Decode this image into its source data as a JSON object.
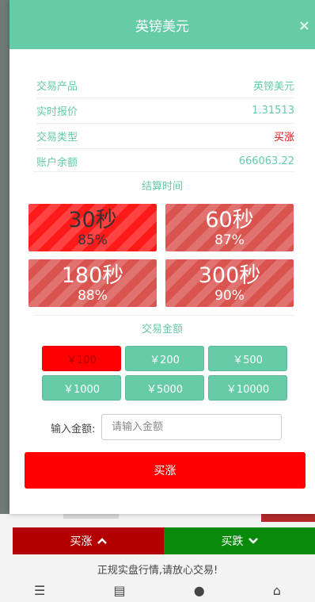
{
  "background": {
    "buy_up_label": "买涨",
    "buy_down_label": "买跌",
    "tagline": "正规实盘行情,请放心交易!"
  },
  "modal": {
    "title": "英镑美元",
    "rows": [
      {
        "label": "交易产品",
        "value": "英镑美元"
      },
      {
        "label": "实时报价",
        "value": "1.31513"
      },
      {
        "label": "交易类型",
        "value": "买涨"
      },
      {
        "label": "账户余额",
        "value": "666063.22"
      }
    ],
    "settle_time_label": "结算时间",
    "time_options": [
      {
        "seconds": "30秒",
        "percent": "85%"
      },
      {
        "seconds": "60秒",
        "percent": "87%"
      },
      {
        "seconds": "180秒",
        "percent": "88%"
      },
      {
        "seconds": "300秒",
        "percent": "90%"
      }
    ],
    "amount_label": "交易金额",
    "amount_options": [
      "￥100",
      "￥200",
      "￥500",
      "￥1000",
      "￥5000",
      "￥10000"
    ],
    "input_label": "输入金额:",
    "input_placeholder": "请输入金额",
    "submit_label": "买涨"
  },
  "colors": {
    "accent": "#66cba7",
    "buy": "#ff0000",
    "sell": "#0a8a0a"
  }
}
